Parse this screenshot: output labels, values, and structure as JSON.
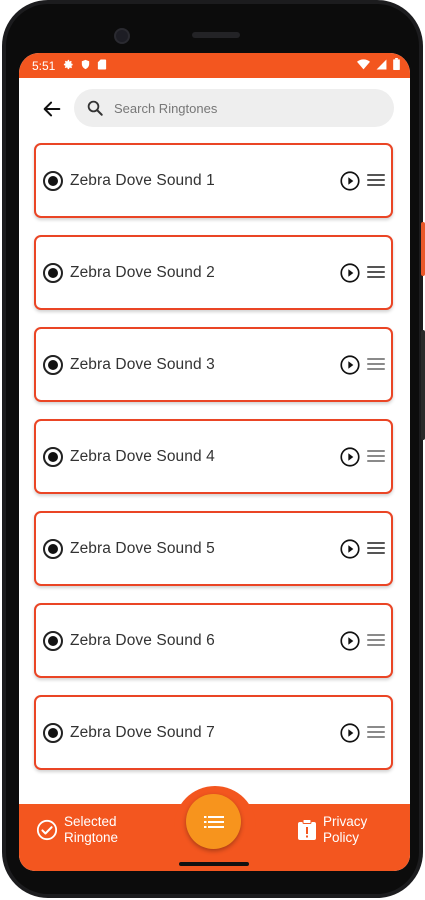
{
  "status_bar": {
    "time": "5:51",
    "left_icons": [
      "settings-icon",
      "shield-icon",
      "sd-card-icon"
    ],
    "right_icons": [
      "wifi-icon",
      "signal-icon",
      "battery-icon"
    ],
    "color": "#f3561f"
  },
  "search": {
    "placeholder": "Search Ringtones"
  },
  "ringtones": [
    {
      "title": "Zebra Dove Sound 1"
    },
    {
      "title": "Zebra Dove Sound 2"
    },
    {
      "title": "Zebra Dove Sound 3"
    },
    {
      "title": "Zebra Dove Sound 4"
    },
    {
      "title": "Zebra Dove Sound 5"
    },
    {
      "title": "Zebra Dove Sound 6"
    },
    {
      "title": "Zebra Dove Sound 7"
    }
  ],
  "bottom_nav": {
    "left_label": "Selected Ringtone",
    "right_label": "Privacy Policy",
    "fab_icon": "list-icon"
  },
  "colors": {
    "accent": "#f3561f",
    "card_border": "#ea4525",
    "fab": "#f7941d"
  }
}
